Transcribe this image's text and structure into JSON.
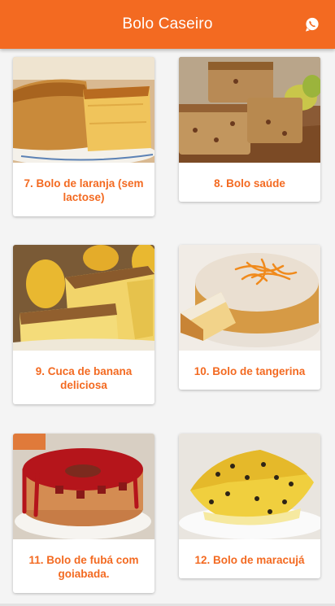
{
  "appbar": {
    "title": "Bolo Caseiro",
    "accent_color": "#f36a21",
    "action_icon": "whatsapp-icon"
  },
  "recipes": [
    {
      "label": "7. Bolo de laranja (sem lactose)",
      "image": "orange-cake-photo"
    },
    {
      "label": "8. Bolo saúde",
      "image": "health-cake-photo"
    },
    {
      "label": "9. Cuca de banana deliciosa",
      "image": "banana-cuca-photo"
    },
    {
      "label": "10. Bolo de tangerina",
      "image": "tangerine-cake-photo"
    },
    {
      "label": "11. Bolo de fubá com goiabada.",
      "image": "cornmeal-guava-cake-photo"
    },
    {
      "label": "12. Bolo de maracujá",
      "image": "passion-fruit-cake-photo"
    }
  ]
}
